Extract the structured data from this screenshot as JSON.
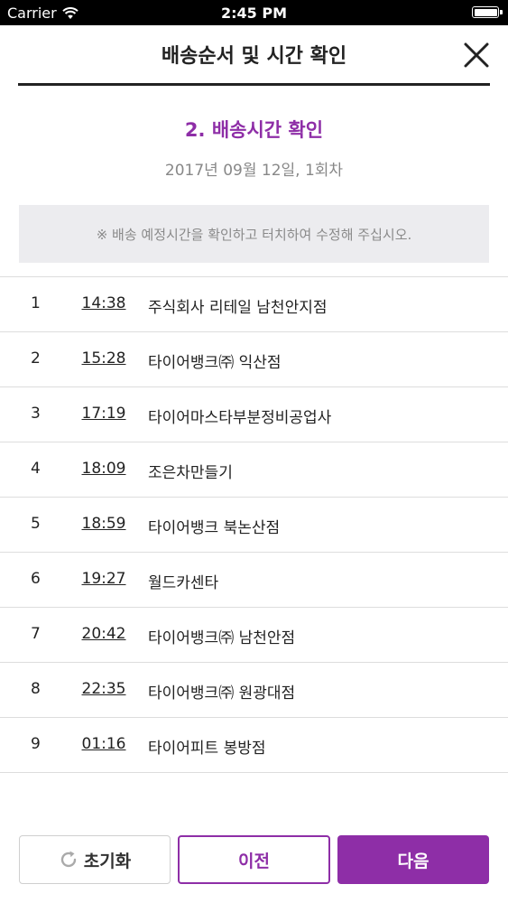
{
  "status_bar": {
    "carrier": "Carrier",
    "time": "2:45 PM"
  },
  "header": {
    "title": "배송순서 및 시간 확인"
  },
  "step": {
    "title": "2. 배송시간 확인",
    "date": "2017년 09월 12일, 1회차"
  },
  "notice": "※ 배송 예정시간을 확인하고 터치하여 수정해 주십시오.",
  "schedule": [
    {
      "num": "1",
      "time": "14:38",
      "name": "주식회사 리테일 남천안지점"
    },
    {
      "num": "2",
      "time": "15:28",
      "name": "타이어뱅크㈜ 익산점"
    },
    {
      "num": "3",
      "time": "17:19",
      "name": "타이어마스타부분정비공업사"
    },
    {
      "num": "4",
      "time": "18:09",
      "name": "조은차만들기"
    },
    {
      "num": "5",
      "time": "18:59",
      "name": "타이어뱅크 북논산점"
    },
    {
      "num": "6",
      "time": "19:27",
      "name": "월드카센타"
    },
    {
      "num": "7",
      "time": "20:42",
      "name": "타이어뱅크㈜ 남천안점"
    },
    {
      "num": "8",
      "time": "22:35",
      "name": "타이어뱅크㈜ 원광대점"
    },
    {
      "num": "9",
      "time": "01:16",
      "name": "타이어피트 봉방점"
    }
  ],
  "buttons": {
    "reset": "초기화",
    "prev": "이전",
    "next": "다음"
  },
  "colors": {
    "accent": "#8e2ea7",
    "status_bar_bg": "#000000",
    "notice_bg": "#ececef"
  },
  "icons": {
    "wifi": "wifi-icon",
    "battery": "battery-icon",
    "close": "close-icon",
    "refresh": "refresh-icon"
  }
}
